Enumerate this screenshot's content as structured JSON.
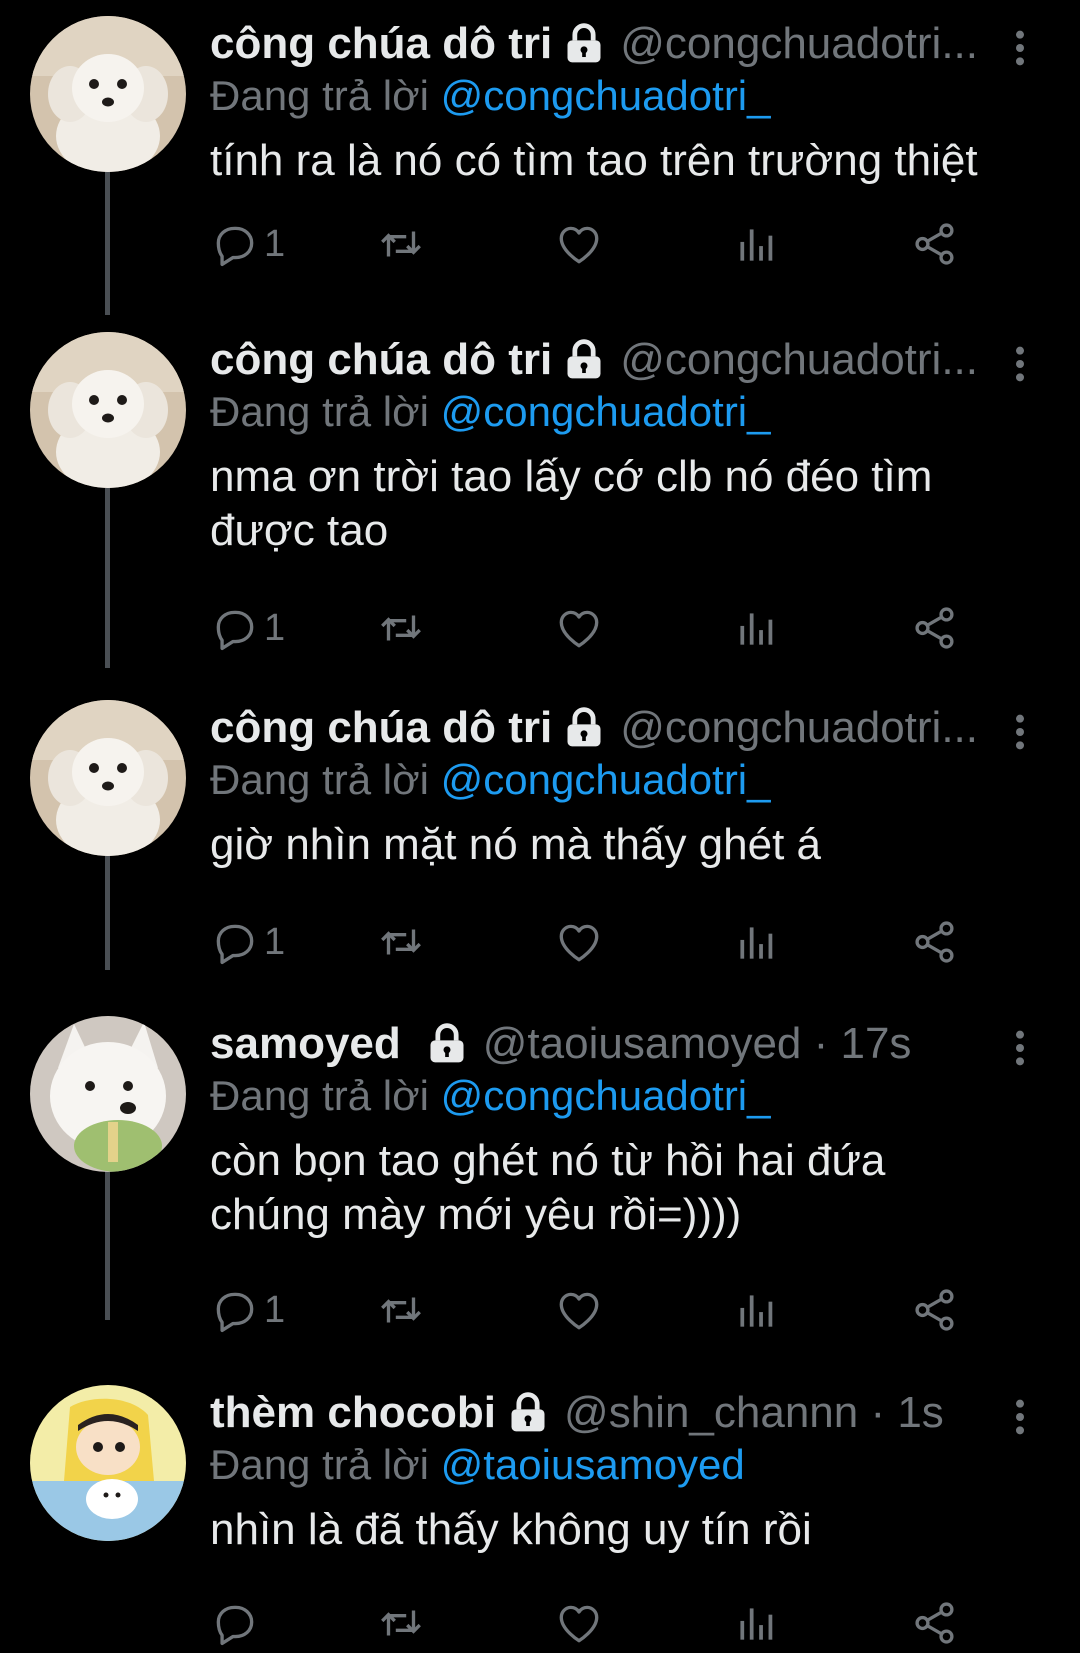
{
  "tweets": [
    {
      "name": "công chúa dô tri",
      "handle": "@congchuadotri...",
      "reply_prefix": "Đang trả lời",
      "reply_mention": "@congchuadotri_",
      "text": "tính ra là nó có tìm tao trên trường thiệt",
      "reply_count": "1"
    },
    {
      "name": "công chúa dô tri",
      "handle": "@congchuadotri...",
      "reply_prefix": "Đang trả lời",
      "reply_mention": "@congchuadotri_",
      "text_line1": "nma ơn trời tao lấy cớ clb nó đéo tìm",
      "text_line2": "được tao",
      "reply_count": "1"
    },
    {
      "name": "công chúa dô tri",
      "handle": "@congchuadotri...",
      "reply_prefix": "Đang trả lời",
      "reply_mention": "@congchuadotri_",
      "text": "giờ nhìn mặt nó mà thấy ghét á",
      "reply_count": "1"
    },
    {
      "name": "samoyed",
      "handle": "@taoiusamoyed · 17s",
      "reply_prefix": "Đang trả lời",
      "reply_mention": "@congchuadotri_",
      "text_line1": "còn bọn tao ghét nó từ hồi hai đứa",
      "text_line2": "chúng mày mới yêu rồi=))))",
      "reply_count": "1"
    },
    {
      "name": "thèm chocobi",
      "handle": "@shin_channn · 1s",
      "reply_prefix": "Đang trả lời",
      "reply_mention": "@taoiusamoyed",
      "text": "nhìn là đã thấy không uy tín rồi",
      "reply_count": ""
    }
  ],
  "icons": {
    "reply": "speech-bubble-icon",
    "retweet": "retweet-arrows-icon",
    "like": "heart-icon",
    "views": "bar-chart-icon",
    "share": "share-nodes-icon",
    "lock": "padlock-icon",
    "more": "vertical-ellipsis-icon"
  },
  "colors": {
    "background": "#000000",
    "text": "#e7e9ea",
    "secondary": "#71767b",
    "mention": "#1d9bf0",
    "thread_line": "#4a4f54"
  }
}
